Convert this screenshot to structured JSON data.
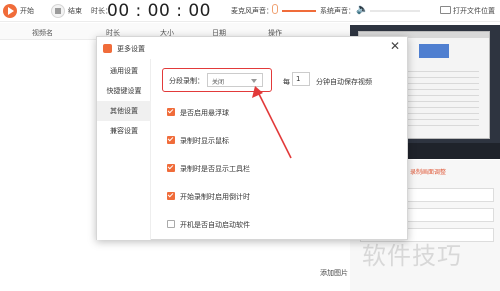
{
  "toolbar": {
    "start_label": "开始",
    "stop_label": "结束",
    "duration_label": "时长：",
    "timer": "00 : 00 : 00",
    "mic_label": "麦克风声音：",
    "system_label": "系统声音：",
    "open_folder_label": "打开文件位置"
  },
  "table_header": {
    "columns": [
      "视频名",
      "时长",
      "大小",
      "日期",
      "操作"
    ]
  },
  "right_panel": {
    "link_text": "录制画面调整",
    "add_image_label": "添加图片"
  },
  "watermark": "软件技巧",
  "dialog": {
    "title": "更多设置",
    "close_glyph": "✕",
    "sidebar": [
      "通用设置",
      "快捷键设置",
      "其他设置",
      "兼容设置"
    ],
    "active_sidebar_index": 2,
    "segment": {
      "label": "分段录制：",
      "value": "关闭",
      "every_label": "每",
      "minutes_value": "1",
      "minutes_suffix": "分钟自动保存视频"
    },
    "options": [
      {
        "label": "是否启用悬浮球",
        "checked": true
      },
      {
        "label": "录制时显示鼠标",
        "checked": true
      },
      {
        "label": "录制时是否显示工具栏",
        "checked": true
      },
      {
        "label": "开始录制时启用倒计时",
        "checked": true
      },
      {
        "label": "开机是否自动启动软件",
        "checked": false
      }
    ]
  },
  "colors": {
    "accent": "#f06c3a",
    "highlight": "#e23a3a"
  }
}
